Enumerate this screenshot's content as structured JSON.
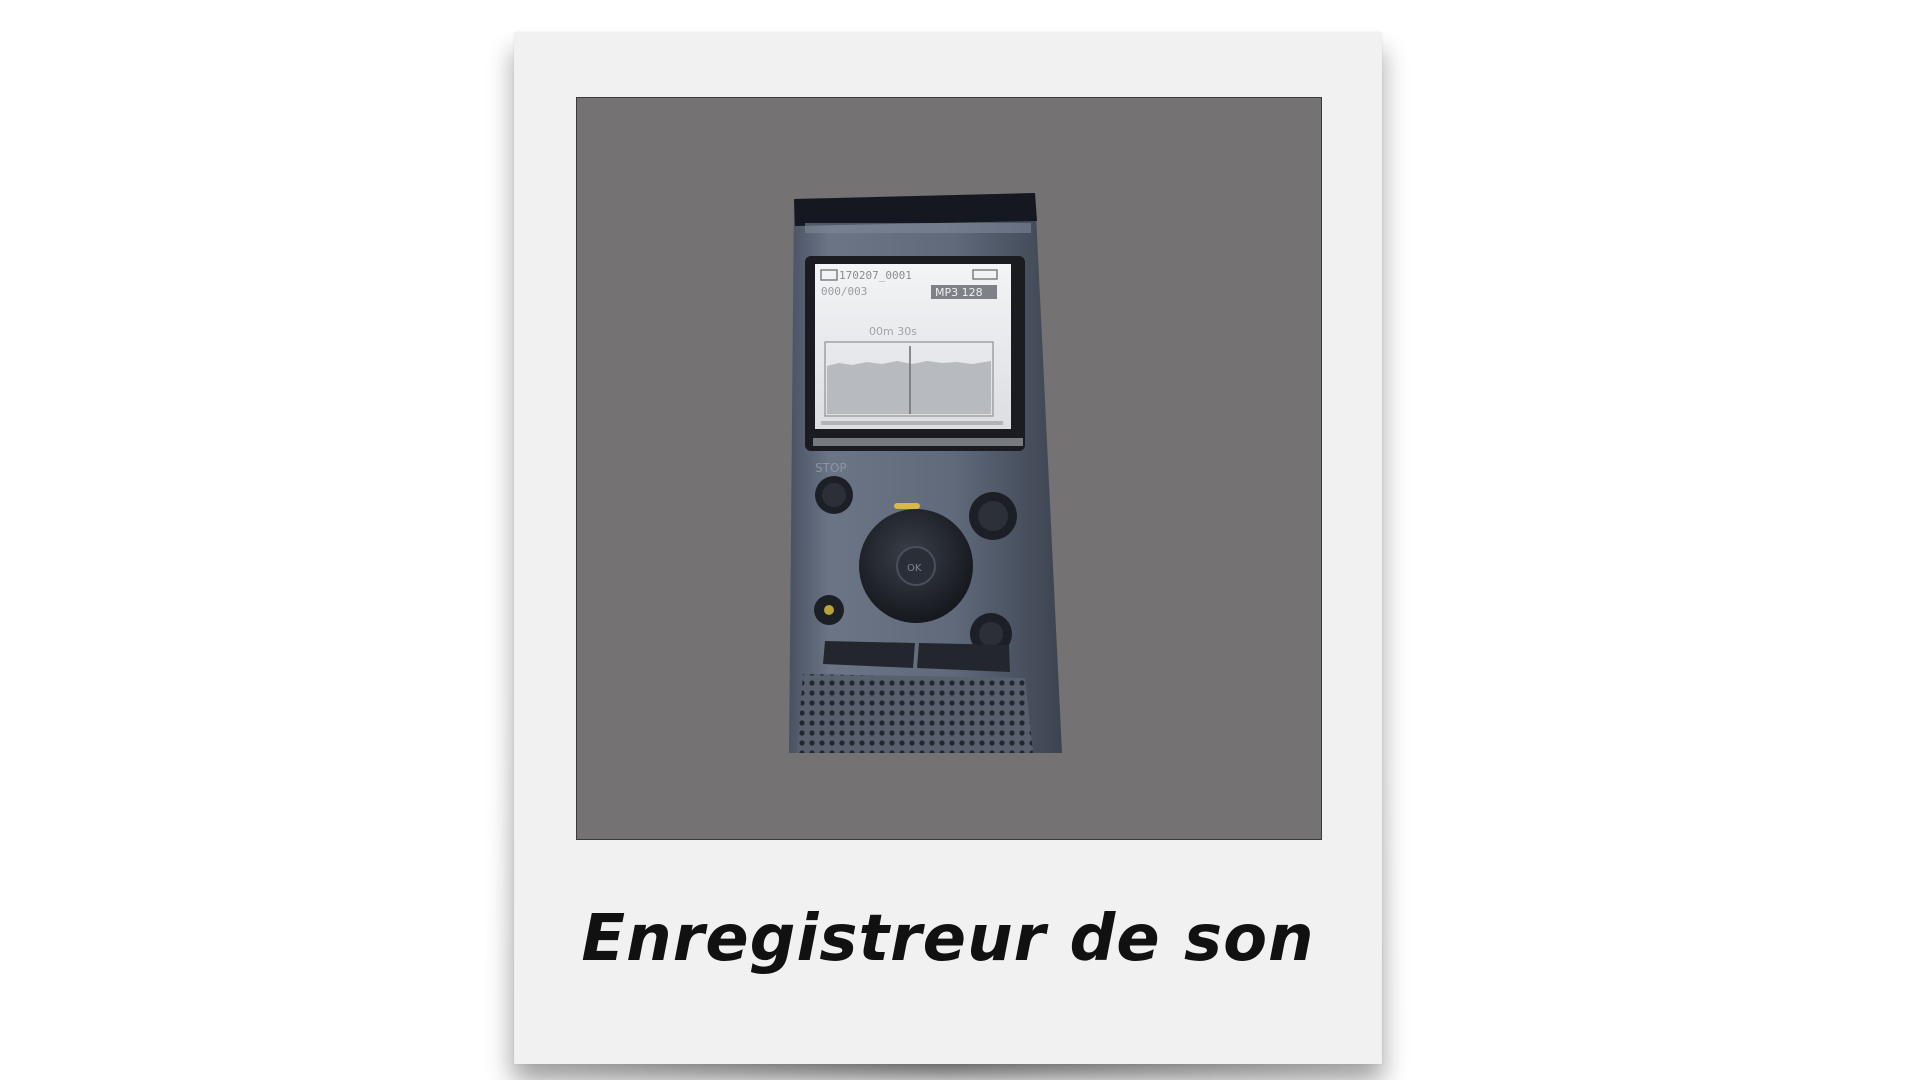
{
  "caption": "Enregistreur de son",
  "colors": {
    "card": "#f1f1f1",
    "photo_background": "#747273",
    "device_body": "#5f6878",
    "screen": "#e9eaec",
    "caption_text": "#111111"
  },
  "device": {
    "screen_line1": "170207_0001",
    "screen_line2": "000/003",
    "screen_format": "MP3 128",
    "screen_timer": "00m 30s",
    "panel_label": "STOP"
  }
}
